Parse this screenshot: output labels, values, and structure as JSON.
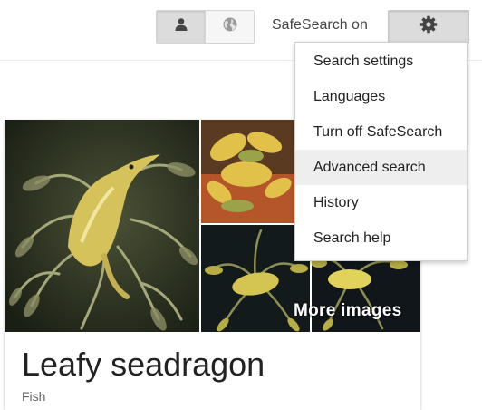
{
  "header": {
    "safesearch_status": "SafeSearch on",
    "toggle_buttons": [
      {
        "icon": "person-icon",
        "active": true
      },
      {
        "icon": "globe-icon",
        "active": false
      }
    ],
    "settings_icon": "gear-icon"
  },
  "settings_menu": {
    "items": [
      {
        "label": "Search settings",
        "highlighted": false
      },
      {
        "label": "Languages",
        "highlighted": false
      },
      {
        "label": "Turn off SafeSearch",
        "highlighted": false
      },
      {
        "label": "Advanced search",
        "highlighted": true
      },
      {
        "label": "History",
        "highlighted": false
      },
      {
        "label": "Search help",
        "highlighted": false
      }
    ]
  },
  "knowledge_panel": {
    "more_images_label": "More images",
    "title": "Leafy seadragon",
    "subtitle": "Fish"
  },
  "colors": {
    "menu_highlight": "#eeeeee",
    "gear_button_bg": "#dcdcdc",
    "toggle_active_bg": "#dcdcdc"
  }
}
